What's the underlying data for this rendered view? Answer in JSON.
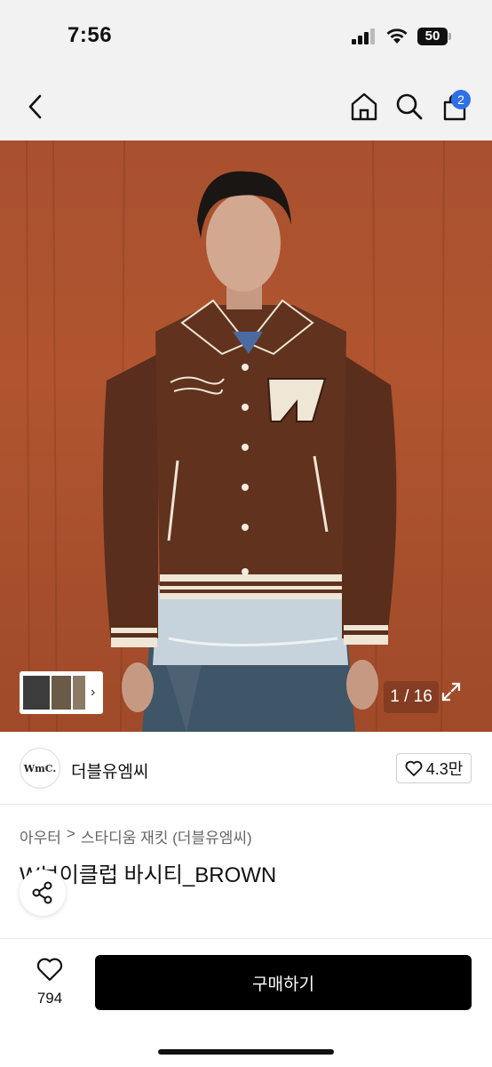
{
  "status": {
    "time": "7:56",
    "battery": "50"
  },
  "nav": {
    "back_icon": "chevron-left-icon",
    "home_icon": "home-icon",
    "search_icon": "search-icon",
    "cart_icon": "bag-icon",
    "cart_badge": "2"
  },
  "gallery": {
    "counter": "1 / 16",
    "thumb_chevron": "›"
  },
  "store": {
    "logo_text": "WmC.",
    "name": "더블유엠씨",
    "likes": "4.3만"
  },
  "product": {
    "breadcrumb": [
      "아우터",
      ">",
      "스타디움 재킷 (더블유엠씨)"
    ],
    "title": "W브이클럽 바시티_BROWN"
  },
  "footer": {
    "wish_count": "794",
    "buy_label": "구매하기"
  },
  "colors": {
    "accent_badge": "#2f6fe8",
    "buy_button": "#000000",
    "jacket": "#5a2e1c"
  }
}
